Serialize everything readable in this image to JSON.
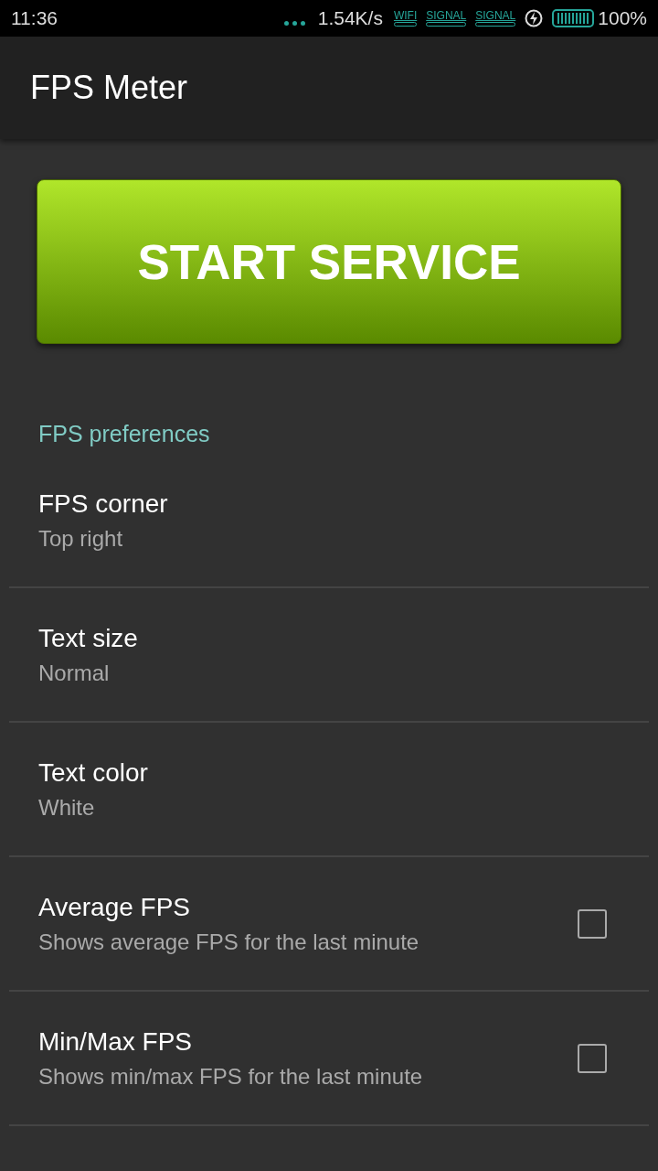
{
  "status_bar": {
    "time": "11:36",
    "network_speed": "1.54K/s",
    "wifi_label": "WIFI",
    "signal_labels": [
      "SIGNAL",
      "SIGNAL"
    ],
    "battery": "100%"
  },
  "app_bar": {
    "title": "FPS Meter"
  },
  "start_button": {
    "label": "START SERVICE"
  },
  "section": {
    "title": "FPS preferences"
  },
  "preferences": [
    {
      "kind": "list",
      "title": "FPS corner",
      "summary": "Top right"
    },
    {
      "kind": "list",
      "title": "Text size",
      "summary": "Normal"
    },
    {
      "kind": "list",
      "title": "Text color",
      "summary": "White"
    },
    {
      "kind": "checkbox",
      "title": "Average FPS",
      "summary": "Shows average FPS for the last minute",
      "checked": false
    },
    {
      "kind": "checkbox",
      "title": "Min/Max FPS",
      "summary": "Shows min/max FPS for the last minute",
      "checked": false
    }
  ]
}
